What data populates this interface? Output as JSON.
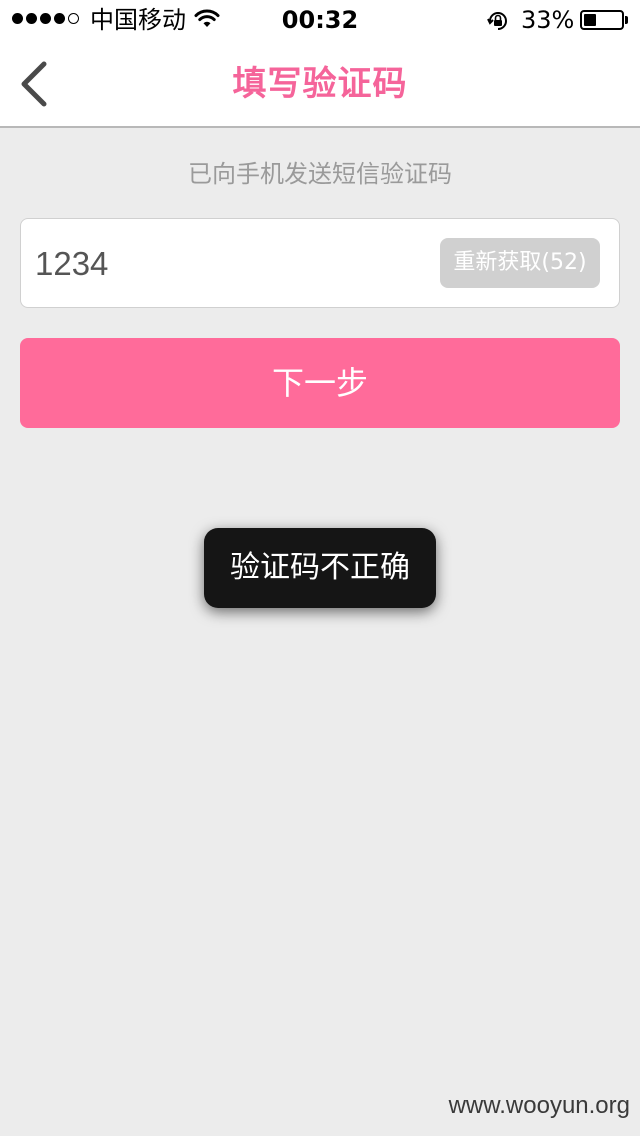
{
  "status_bar": {
    "signal_bars_filled": 4,
    "signal_bars_total": 5,
    "carrier": "中国移动",
    "wifi_icon": "wifi-icon",
    "time": "00:32",
    "rotation_lock_icon": "rotation-lock-icon",
    "battery_percent": "33%",
    "battery_level": 0.33
  },
  "nav": {
    "back_icon": "chevron-left-icon",
    "title": "填写验证码"
  },
  "main": {
    "hint": "已向手机发送短信验证码",
    "code_input_value": "1234",
    "resend_label": "重新获取(52)",
    "next_label": "下一步"
  },
  "toast": {
    "message": "验证码不正确"
  },
  "watermark": "www.wooyun.org",
  "colors": {
    "accent": "#f5649a",
    "button": "#ff6b9a",
    "resend_disabled": "#d0d0d0",
    "toast_bg": "#151515",
    "background": "#ececec"
  }
}
